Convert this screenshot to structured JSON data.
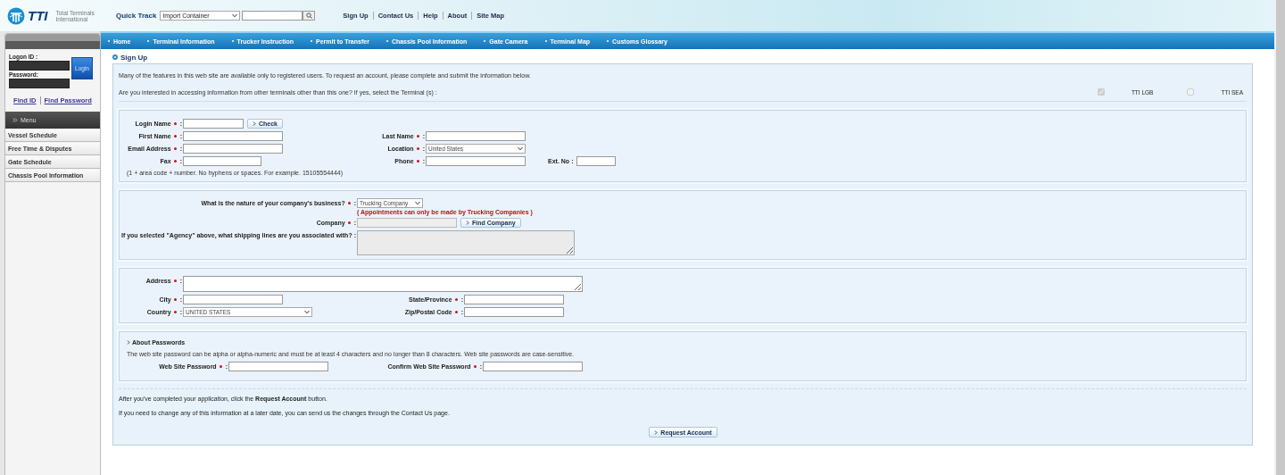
{
  "header": {
    "logo": {
      "mark": "TTI",
      "subtitle": "Total Terminals International"
    },
    "quick_track": {
      "label": "Quick Track",
      "select_value": "Import Container"
    },
    "links": [
      "Sign Up",
      "Contact Us",
      "Help",
      "About",
      "Site Map"
    ]
  },
  "nav": {
    "items": [
      "Home",
      "Terminal Information",
      "Trucker Instruction",
      "Permit to Transfer",
      "Chassis Pool Information",
      "Gate Camera",
      "Terminal Map",
      "Customs Glossary"
    ]
  },
  "sidebar": {
    "logon_label": "Logon ID :",
    "password_label": "Password:",
    "login_button": "Login",
    "links": [
      "Find ID",
      "Find Password"
    ],
    "menu_title": "Menu",
    "menu_items": [
      "Vessel Schedule",
      "Free Time & Disputes",
      "Gate Schedule",
      "Chassis Pool Information"
    ]
  },
  "page_title": "Sign Up",
  "intro": "Many of the features in this web site are available only to registered users. To request an account, please complete and submit the information below.",
  "terminal_question": "Are you interested in accessing information from other terminals other than this one? If yes, select the Terminal (s) :",
  "terminals": [
    {
      "label": "TTI LGB",
      "checked": true,
      "disabled": true
    },
    {
      "label": "TTI SEA",
      "checked": false,
      "disabled": true
    }
  ],
  "sections": [
    {
      "kind": "contact",
      "note": "(1 + area code + number. No hyphens or spaces. For example. 15105554444)",
      "rows": [
        [
          {
            "label": "Login Name",
            "required": true,
            "suffix": ":",
            "kind": "text",
            "button": "Check"
          }
        ],
        [
          {
            "label": "First Name",
            "required": true,
            "suffix": ":",
            "kind": "text"
          },
          {
            "label": "Last Name",
            "required": true,
            "suffix": ":",
            "kind": "text"
          }
        ],
        [
          {
            "label": "Email Address",
            "required": true,
            "suffix": ":",
            "kind": "text"
          },
          {
            "label": "Location",
            "required": true,
            "suffix": ":",
            "kind": "select",
            "value": "United States"
          }
        ],
        [
          {
            "label": "Fax",
            "required": true,
            "suffix": ":",
            "kind": "text"
          },
          {
            "label": "Phone",
            "required": true,
            "suffix": ":",
            "kind": "text",
            "extra": {
              "label": "Ext. No",
              "suffix": ":",
              "kind": "text"
            }
          }
        ]
      ]
    },
    {
      "kind": "business",
      "rows": [
        [
          {
            "label": "What is the nature of your company's business?",
            "required": true,
            "suffix": ":",
            "kind": "select",
            "value": "Trucking Company",
            "note": "( Appointments can only be made by Trucking Companies )"
          }
        ],
        [
          {
            "label": "Company",
            "required": true,
            "suffix": ":",
            "kind": "text",
            "disabled": true,
            "button": "Find Company"
          }
        ],
        [
          {
            "label": "If you selected \"Agency\" above, what shipping lines are you associated with?",
            "required": false,
            "suffix": ":",
            "kind": "textarea",
            "disabled": true
          }
        ]
      ]
    },
    {
      "kind": "address",
      "rows": [
        [
          {
            "label": "Address",
            "required": true,
            "suffix": ":",
            "kind": "textarea"
          }
        ],
        [
          {
            "label": "City",
            "required": true,
            "suffix": ":",
            "kind": "text"
          },
          {
            "label": "State/Province",
            "required": true,
            "suffix": ":",
            "kind": "text"
          }
        ],
        [
          {
            "label": "Country",
            "required": true,
            "suffix": ":",
            "kind": "select",
            "value": "UNITED STATES"
          },
          {
            "label": "Zip/Postal Code",
            "required": true,
            "suffix": ":",
            "kind": "text"
          }
        ]
      ]
    },
    {
      "kind": "password",
      "heading": "About Passwords",
      "text": "The web site password can be alpha or alpha-numeric and must be at least 4 characters and no longer than 8 characters. Web site passwords are case-sensitive.",
      "rows": [
        [
          {
            "label": "Web Site Password",
            "required": true,
            "suffix": ":",
            "kind": "text"
          },
          {
            "label": "Confirm Web Site Password",
            "required": true,
            "suffix": ":",
            "kind": "text"
          }
        ]
      ]
    }
  ],
  "footer_notes": [
    "After you've completed your application, click the **Request Account** button.",
    "If you need to change any of this information at a later date, you can send us the changes through the Contact Us page."
  ],
  "submit_button": "Request Account"
}
